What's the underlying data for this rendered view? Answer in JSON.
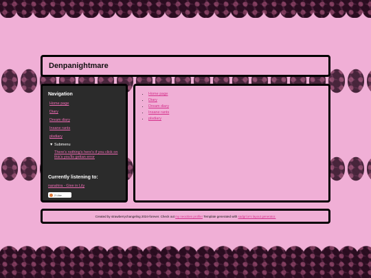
{
  "site": {
    "title": "Denpanightmare"
  },
  "sidebar": {
    "heading": "Navigation",
    "items": [
      {
        "label": "Home page"
      },
      {
        "label": "Diary"
      },
      {
        "label": "Dream diary"
      },
      {
        "label": "Insane rants"
      },
      {
        "label": "plsdiary"
      }
    ],
    "submenu": {
      "label": "▼ Submenu",
      "link": "There's nothing's here's if you click on this's you'lls gettan error"
    },
    "listening": {
      "heading": "Currently listening to:",
      "track": "nanahira - Give in Lily"
    },
    "badge": {
      "count": "2 Like"
    }
  },
  "main": {
    "links": [
      {
        "label": "Home page"
      },
      {
        "label": "Diary"
      },
      {
        "label": "Dream diary"
      },
      {
        "label": "Insane rants"
      },
      {
        "label": "plsdiary"
      }
    ]
  },
  "footer": {
    "part1": "Created by strawberrychangeling 2024-forever. Check out",
    "link1": "my neocities profile!",
    "part2": "Template generated with",
    "link2": "sadgrl.ie's layout generator."
  },
  "colors": {
    "background": "#f0afd6",
    "sidebar": "#2b2b2b",
    "link": "#f06bb4",
    "border": "#000000"
  }
}
